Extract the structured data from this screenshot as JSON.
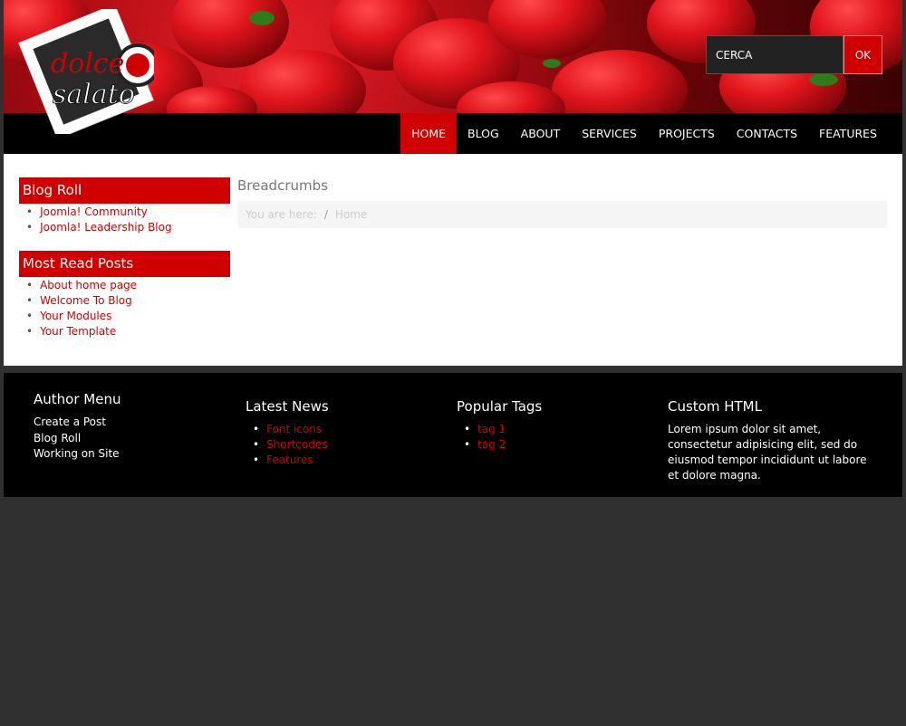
{
  "header": {
    "logo_line1": "dolce",
    "logo_line2": "salato",
    "search": {
      "placeholder": "CERCA",
      "button_label": "OK"
    }
  },
  "nav": {
    "items": [
      "HOME",
      "BLOG",
      "ABOUT",
      "SERVICES",
      "PROJECTS",
      "CONTACTS",
      "FEATURES"
    ],
    "active": "HOME"
  },
  "sidebar": {
    "blog_roll": {
      "title": "Blog Roll",
      "items": [
        "Joomla! Community",
        "Joomla! Leadership Blog"
      ]
    },
    "most_read": {
      "title": "Most Read Posts",
      "items": [
        "About home page",
        "Welcome To Blog",
        "Your Modules",
        "Your Template"
      ]
    }
  },
  "breadcrumbs": {
    "title": "Breadcrumbs",
    "prefix": "You are here:",
    "separator": "/",
    "current": "Home"
  },
  "footer": {
    "author_menu": {
      "title": "Author Menu",
      "items": [
        "Create a Post",
        "Blog Roll",
        "Working on Site"
      ]
    },
    "latest_news": {
      "title": "Latest News",
      "items": [
        "Font icons",
        "Shortcodes",
        "Features"
      ]
    },
    "popular_tags": {
      "title": "Popular Tags",
      "items": [
        "tag 1",
        "tag 2"
      ]
    },
    "custom_html": {
      "title": "Custom HTML",
      "text": "Lorem ipsum dolor sit amet, consectetur adipisicing elit, sed do eiusmod tempor incididunt ut labore et dolore magna."
    }
  },
  "colors": {
    "accent": "#d10000",
    "page_bg": "#303030",
    "bar_bg": "#000000"
  }
}
